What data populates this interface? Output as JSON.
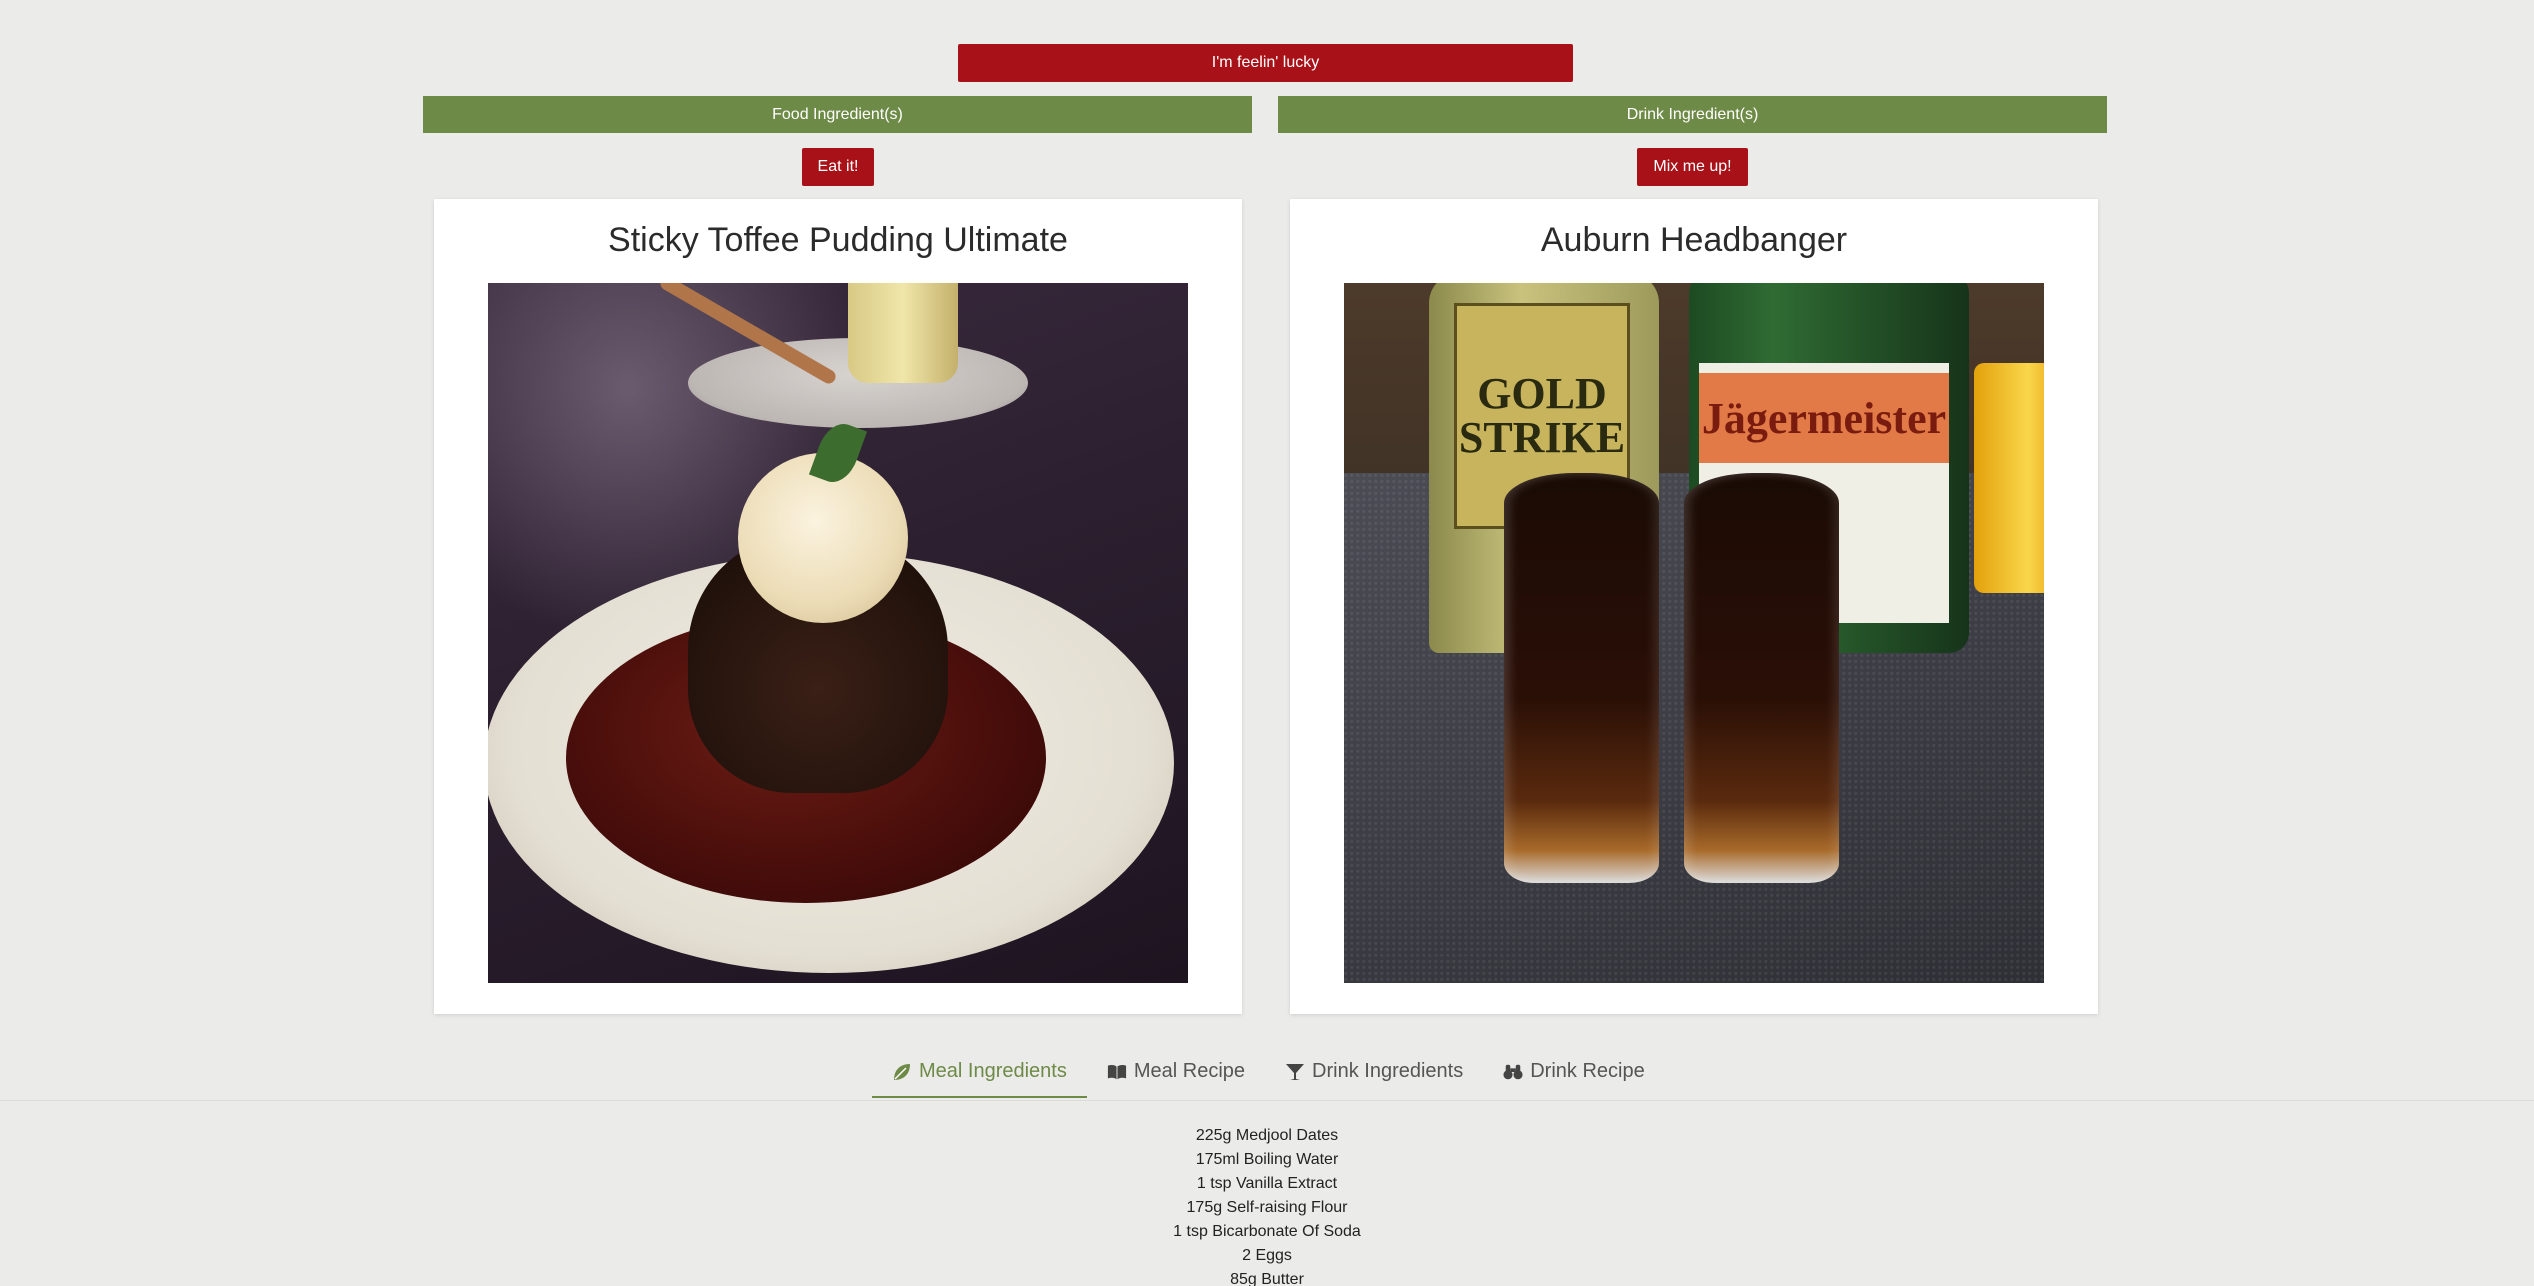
{
  "controls": {
    "lucky_label": "I'm feelin' lucky",
    "food_placeholder": "Food Ingredient(s)",
    "drink_placeholder": "Drink Ingredient(s)",
    "eat_label": "Eat it!",
    "mix_label": "Mix me up!"
  },
  "meal": {
    "title": "Sticky Toffee Pudding Ultimate"
  },
  "drink": {
    "title": "Auburn Headbanger",
    "bottle_left_label": "GOLD STRIKE",
    "bottle_right_label": "Jägermeister"
  },
  "tabs": [
    {
      "label": "Meal Ingredients",
      "icon": "leaf-icon",
      "active": true
    },
    {
      "label": "Meal Recipe",
      "icon": "book-open-icon",
      "active": false
    },
    {
      "label": "Drink Ingredients",
      "icon": "cocktail-glass-icon",
      "active": false
    },
    {
      "label": "Drink Recipe",
      "icon": "binoculars-icon",
      "active": false
    }
  ],
  "meal_ingredients": [
    "225g Medjool Dates",
    "175ml Boiling Water",
    "1 tsp Vanilla Extract",
    "175g Self-raising Flour",
    "1 tsp Bicarbonate Of Soda",
    "2 Eggs",
    "85g Butter"
  ],
  "colors": {
    "accent_red": "#a81117",
    "accent_green": "#6e8a47",
    "background": "#ebebe9"
  }
}
